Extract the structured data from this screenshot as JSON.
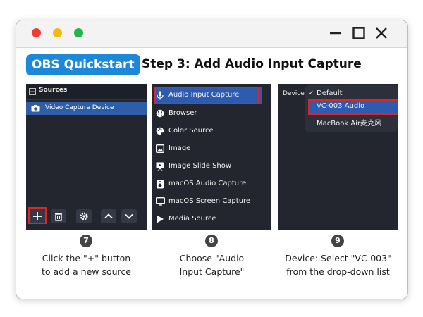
{
  "window": {
    "controls": [
      "close",
      "minimize",
      "maximize"
    ],
    "control_colors": {
      "red": "#ee3d35",
      "yellow": "#f7b90f",
      "green": "#28b34a"
    }
  },
  "header": {
    "badge": "OBS Quickstart",
    "badge_color": "#1e88d8",
    "step_title": "Step 3: Add Audio Input Capture"
  },
  "panel1": {
    "title": "Sources",
    "source_item": "Video Capture Device",
    "toolbar_icons": [
      "plus-icon",
      "trash-icon",
      "gear-icon",
      "chevron-up-icon",
      "chevron-down-icon"
    ]
  },
  "panel2": {
    "items": [
      {
        "label": "Audio Input Capture",
        "icon": "microphone-icon",
        "highlighted": true
      },
      {
        "label": "Browser",
        "icon": "globe-icon"
      },
      {
        "label": "Color Source",
        "icon": "palette-icon"
      },
      {
        "label": "Image",
        "icon": "image-icon"
      },
      {
        "label": "Image Slide Show",
        "icon": "slideshow-icon"
      },
      {
        "label": "macOS Audio Capture",
        "icon": "speaker-icon"
      },
      {
        "label": "macOS Screen Capture",
        "icon": "monitor-icon"
      },
      {
        "label": "Media Source",
        "icon": "play-icon"
      }
    ]
  },
  "panel3": {
    "device_label": "Device",
    "options": [
      {
        "label": "Default",
        "checked": true
      },
      {
        "label": "VC-003 Audio",
        "highlighted": true
      },
      {
        "label": "MacBook Air麦克风"
      }
    ]
  },
  "steps": [
    {
      "number": "7",
      "line1": "Click the \"+\" button",
      "line2": "to add a new source"
    },
    {
      "number": "8",
      "line1": "Choose \"Audio",
      "line2": "Input Capture\""
    },
    {
      "number": "9",
      "line1": "Device: Select \"VC-003\"",
      "line2": "from the drop-down list"
    }
  ],
  "colors": {
    "highlight": "#2c5bb0",
    "callout": "#e02424",
    "panel_bg": "#23262f"
  }
}
